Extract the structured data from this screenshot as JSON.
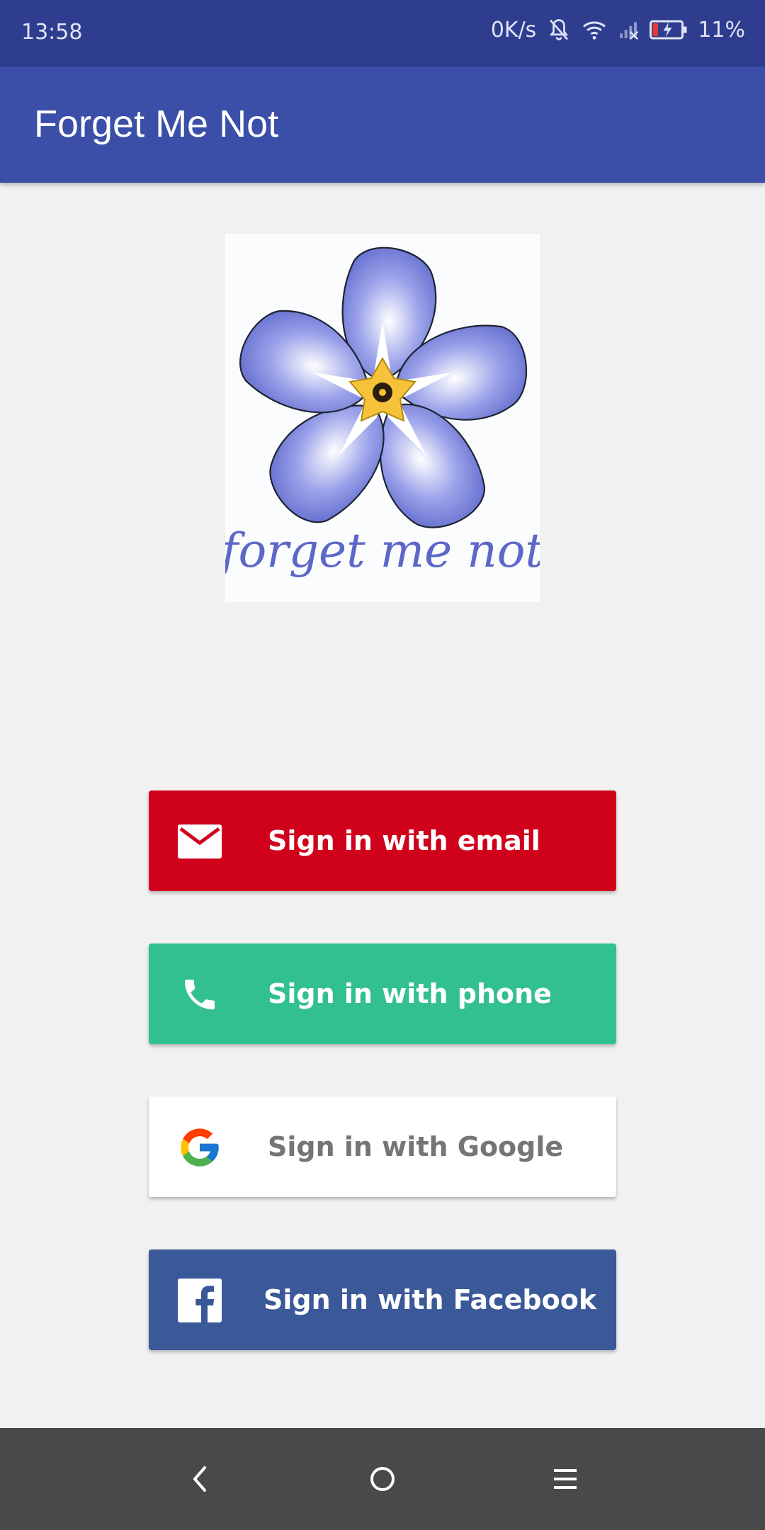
{
  "status_bar": {
    "time": "13:58",
    "net_speed": "0K/s",
    "battery_percent": "11%",
    "icons": [
      "notifications-off-icon",
      "wifi-icon",
      "signal-icon",
      "battery-charging-icon"
    ]
  },
  "app_bar": {
    "title": "Forget Me Not"
  },
  "logo": {
    "script_text": "forget me not"
  },
  "buttons": {
    "email": {
      "label": "Sign in with email",
      "icon": "mail-icon",
      "color": "#d0021b"
    },
    "phone": {
      "label": "Sign in with phone",
      "icon": "phone-icon",
      "color": "#32c08f"
    },
    "google": {
      "label": "Sign in with Google",
      "icon": "google-icon",
      "color": "#ffffff"
    },
    "facebook": {
      "label": "Sign in with Facebook",
      "icon": "facebook-icon",
      "color": "#3b5998"
    }
  },
  "nav_bar": {
    "icons": [
      "back-icon",
      "home-icon",
      "menu-icon"
    ]
  }
}
